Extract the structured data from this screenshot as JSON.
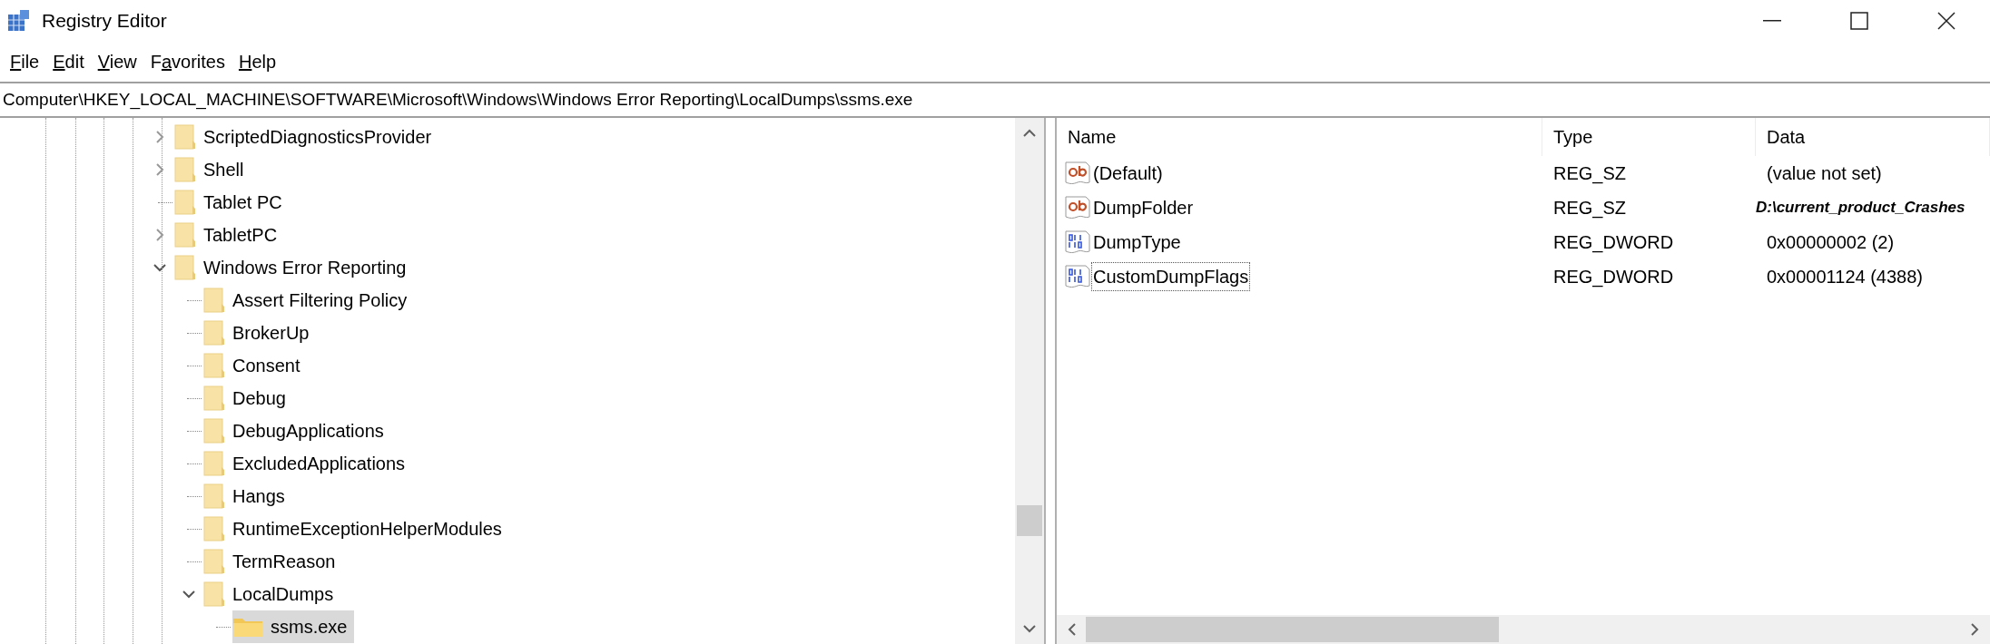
{
  "window": {
    "title": "Registry Editor"
  },
  "menu": [
    {
      "access_key": "F",
      "label_rest": "ile"
    },
    {
      "access_key": "E",
      "label_rest": "dit"
    },
    {
      "access_key": "V",
      "label_rest": "iew"
    },
    {
      "label_start": "F",
      "access_key": "a",
      "label_rest": "vorites"
    },
    {
      "access_key": "H",
      "label_rest": "elp"
    }
  ],
  "address_bar": {
    "value": "Computer\\HKEY_LOCAL_MACHINE\\SOFTWARE\\Microsoft\\Windows\\Windows Error Reporting\\LocalDumps\\ssms.exe"
  },
  "tree": [
    {
      "label": "ScriptedDiagnosticsProvider",
      "kind": "branch",
      "expanded": false,
      "selected": false
    },
    {
      "label": "Shell",
      "kind": "branch",
      "expanded": false,
      "selected": false
    },
    {
      "label": "Tablet PC",
      "kind": "leaf",
      "selected": false
    },
    {
      "label": "TabletPC",
      "kind": "branch",
      "expanded": false,
      "selected": false
    },
    {
      "label": "Windows Error Reporting",
      "kind": "branch",
      "expanded": true,
      "selected": false,
      "children": [
        {
          "label": "Assert Filtering Policy",
          "kind": "leaf",
          "selected": false
        },
        {
          "label": "BrokerUp",
          "kind": "leaf",
          "selected": false
        },
        {
          "label": "Consent",
          "kind": "leaf",
          "selected": false
        },
        {
          "label": "Debug",
          "kind": "leaf",
          "selected": false
        },
        {
          "label": "DebugApplications",
          "kind": "leaf",
          "selected": false
        },
        {
          "label": "ExcludedApplications",
          "kind": "leaf",
          "selected": false
        },
        {
          "label": "Hangs",
          "kind": "leaf",
          "selected": false
        },
        {
          "label": "RuntimeExceptionHelperModules",
          "kind": "leaf",
          "selected": false
        },
        {
          "label": "TermReason",
          "kind": "leaf",
          "selected": false
        },
        {
          "label": "LocalDumps",
          "kind": "branch",
          "expanded": true,
          "selected": false,
          "children": [
            {
              "label": "ssms.exe",
              "kind": "leaf",
              "selected": true
            }
          ]
        }
      ]
    }
  ],
  "values_table": {
    "columns": [
      "Name",
      "Type",
      "Data"
    ],
    "rows": [
      {
        "name": "(Default)",
        "kind": "string",
        "type": "REG_SZ",
        "data": "(value not set)",
        "focused": false,
        "emphasized": false
      },
      {
        "name": "DumpFolder",
        "kind": "string",
        "type": "REG_SZ",
        "data": "D:\\current_product_Crashes",
        "focused": false,
        "emphasized": true
      },
      {
        "name": "DumpType",
        "kind": "dword",
        "type": "REG_DWORD",
        "data": "0x00000002 (2)",
        "focused": false,
        "emphasized": false
      },
      {
        "name": "CustomDumpFlags",
        "kind": "dword",
        "type": "REG_DWORD",
        "data": "0x00001124 (4388)",
        "focused": true,
        "emphasized": false
      }
    ]
  }
}
